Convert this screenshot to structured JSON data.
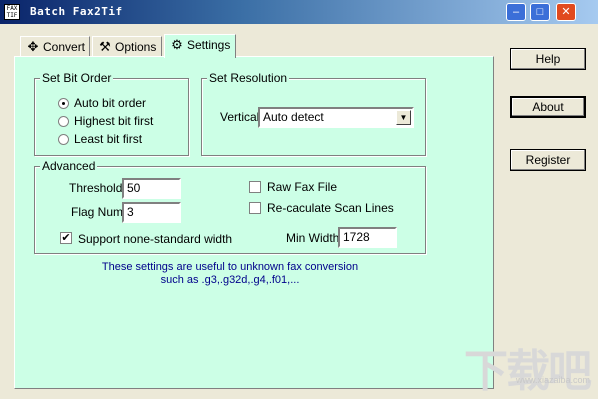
{
  "window": {
    "title": "Batch Fax2Tif",
    "icon_text": "FAX TIF",
    "minimize_glyph": "–",
    "maximize_glyph": "□",
    "close_glyph": "✕"
  },
  "tabs": [
    {
      "label": "Convert",
      "icon": "move-arrows-icon",
      "glyph": "✥"
    },
    {
      "label": "Options",
      "icon": "tools-icon",
      "glyph": "⚒"
    },
    {
      "label": "Settings",
      "icon": "settings-icon",
      "glyph": "⚙"
    }
  ],
  "bit_order": {
    "title": "Set Bit Order",
    "options": [
      {
        "label": "Auto bit order",
        "selected": true
      },
      {
        "label": "Highest bit first",
        "selected": false
      },
      {
        "label": "Least bit first",
        "selected": false
      }
    ]
  },
  "resolution": {
    "title": "Set Resolution",
    "vertical_label": "Vertical",
    "vertical_value": "Auto detect",
    "arrow_glyph": "▼"
  },
  "advanced": {
    "title": "Advanced",
    "threshold_label": "Threshold",
    "threshold_value": "50",
    "flag_num_label": "Flag Num",
    "flag_num_value": "3",
    "support_label": "Support none-standard width",
    "support_checked": true,
    "raw_fax_label": "Raw Fax File",
    "raw_fax_checked": false,
    "recalc_label": "Re-caculate Scan Lines",
    "recalc_checked": false,
    "min_width_label": "Min Width",
    "min_width_value": "1728",
    "check_glyph": "✔"
  },
  "info": {
    "line1": "These settings are useful to unknown fax conversion",
    "line2": "such as .g3,.g32d,.g4,.f01,..."
  },
  "buttons": {
    "help": "Help",
    "about": "About",
    "register": "Register"
  },
  "watermark": {
    "main": "下载吧",
    "url": "www.xiazaiba.com"
  }
}
